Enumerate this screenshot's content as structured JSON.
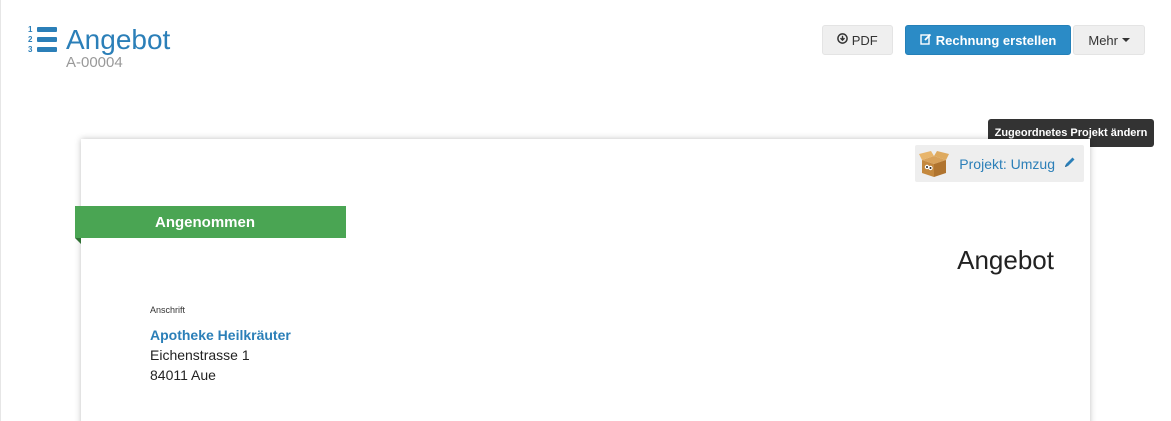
{
  "header": {
    "title": "Angebot",
    "number": "A-00004",
    "icon": "ordered-list-icon",
    "list_numbers": [
      "1",
      "2",
      "3"
    ]
  },
  "toolbar": {
    "pdf_label": "PDF",
    "invoice_label": "Rechnung erstellen",
    "more_label": "Mehr"
  },
  "tooltip": {
    "text": "Zugeordnetes Projekt ändern"
  },
  "document": {
    "project_label": "Projekt: Umzug",
    "status": "Angenommen",
    "heading": "Angebot",
    "address": {
      "label": "Anschrift",
      "name": "Apotheke Heilkräuter",
      "street": "Eichenstrasse 1",
      "city": "84011 Aue"
    }
  },
  "colors": {
    "accent": "#2b7fb8",
    "primary_button": "#2b8bc6",
    "status_green": "#4aa553"
  }
}
